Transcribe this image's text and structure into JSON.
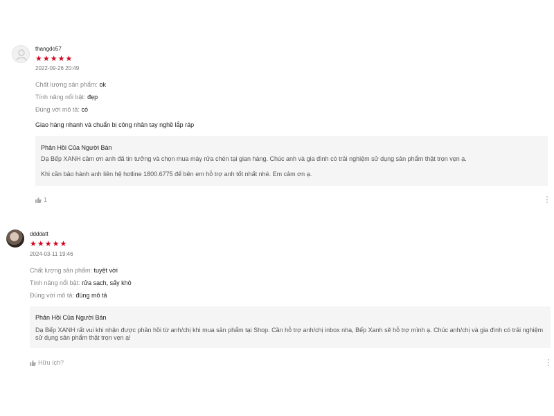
{
  "reviews": [
    {
      "username": "thangdo57",
      "stars": "★★★★★",
      "date": "2022-09-26 20:49",
      "attributes": [
        {
          "label": "Chất lượng sản phẩm:",
          "value": "ok"
        },
        {
          "label": "Tính năng nổi bật:",
          "value": "đẹp"
        },
        {
          "label": "Đúng với mô tả:",
          "value": "có"
        }
      ],
      "comment": "Giao hàng nhanh và chuẩn bị công nhân tay nghề lắp ráp",
      "seller_reply": {
        "title": "Phản Hồi Của Người Bán",
        "paragraphs": [
          "Dạ Bếp XANH cảm ơn anh đã tin tưởng và chọn mua máy rửa chén tại gian hàng. Chúc anh và gia đình có trải nghiệm sử dụng sản phẩm thật trọn vẹn ạ.",
          "Khi cần bảo hành anh liên hệ hotline 1800.6775 để bên em hỗ trợ anh tốt nhất nhé. Em cảm ơn ạ."
        ]
      },
      "like_label": "1"
    },
    {
      "username": "ddddatt",
      "stars": "★★★★★",
      "date": "2024-03-11 19:46",
      "attributes": [
        {
          "label": "Chất lượng sản phẩm:",
          "value": "tuyệt vời"
        },
        {
          "label": "Tính năng nổi bật:",
          "value": "rửa sạch, sấy khô"
        },
        {
          "label": "Đúng với mô tả:",
          "value": "đúng mô tả"
        }
      ],
      "comment": "",
      "seller_reply": {
        "title": "Phản Hồi Của Người Bán",
        "paragraphs": [
          "Dạ Bếp XANH rất vui khi nhận được phản hồi từ anh/chị khi mua sản phẩm tại Shop. Cần hỗ trợ anh/chị inbox nha, Bếp Xanh sẽ hỗ trợ mình ạ. Chúc anh/chị và gia đình có trải nghiệm sử dụng sản phẩm thật trọn vẹn ạ!"
        ]
      },
      "like_label": "Hữu ích?"
    }
  ],
  "colors": {
    "star": "#d0011b",
    "reply_bg": "#f5f5f5",
    "muted": "#888888"
  },
  "icons": {
    "avatar_default": "user-icon",
    "like": "thumbs-up-icon",
    "more": "more-vertical-icon"
  }
}
